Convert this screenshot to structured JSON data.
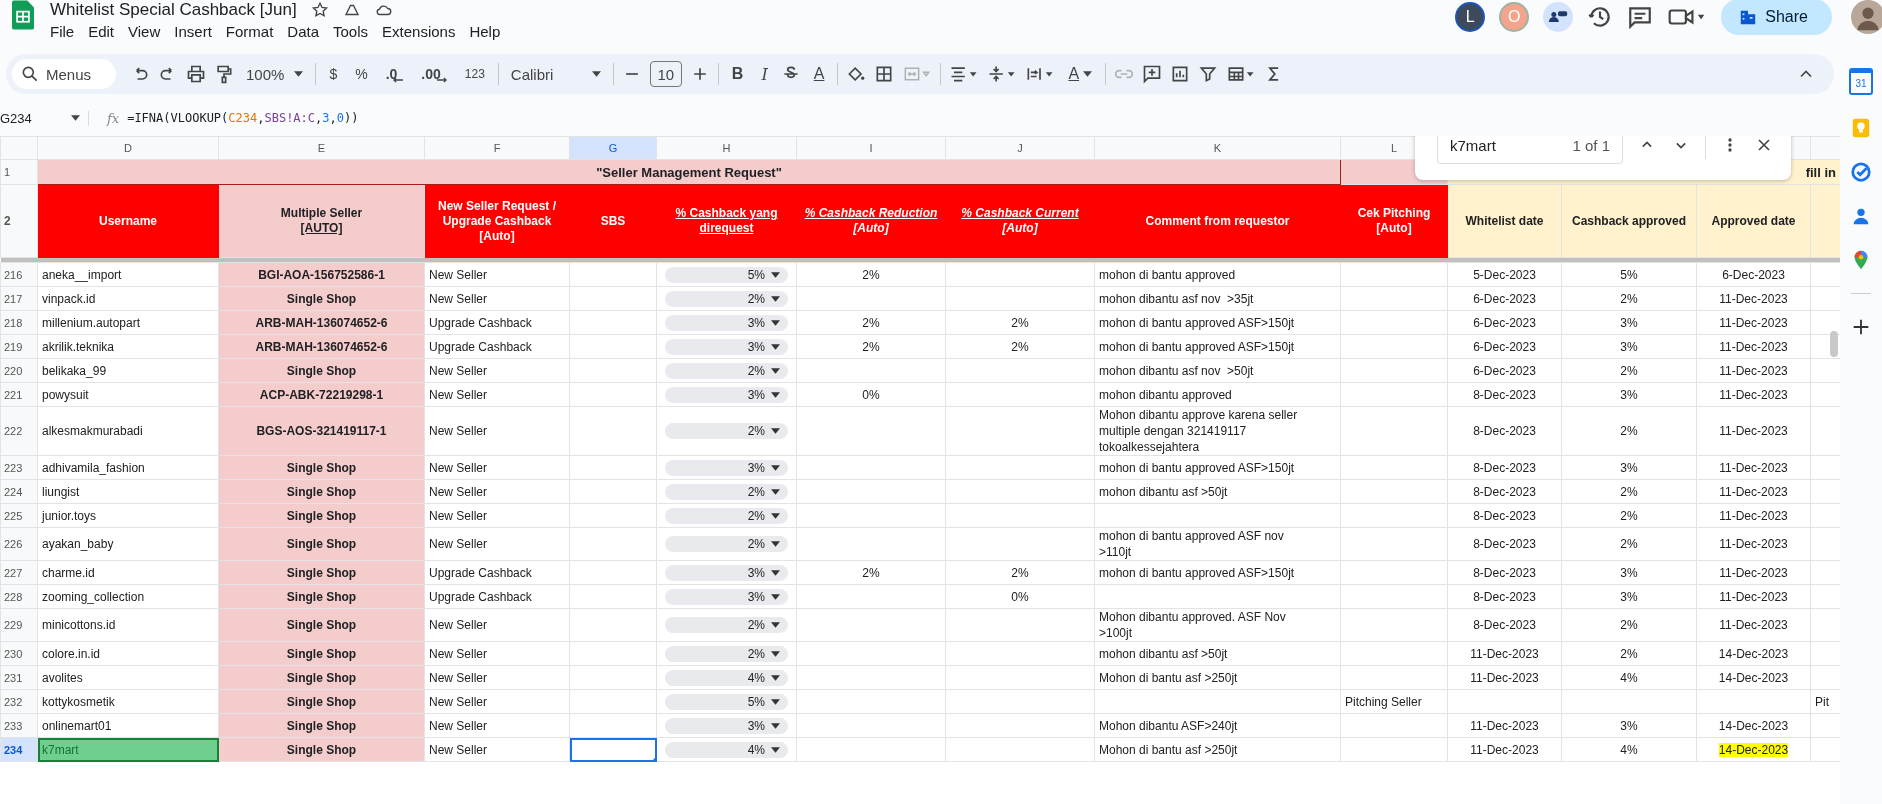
{
  "title": "Whitelist Special Cashback [Jun]",
  "menu": [
    "File",
    "Edit",
    "View",
    "Insert",
    "Format",
    "Data",
    "Tools",
    "Extensions",
    "Help"
  ],
  "collaborators": [
    {
      "initial": "L",
      "color": "#3c4a5c"
    },
    {
      "initial": "O",
      "color": "#f4a48c"
    }
  ],
  "share_label": "Share",
  "toolbar": {
    "search": "Menus",
    "zoom": "100%",
    "currency": "$",
    "percent": "%",
    "decrease_decimals": ".0",
    "increase_decimals": ".00",
    "number_format": "123",
    "font": "Calibri",
    "font_size": "10",
    "bold": "B",
    "italic": "I",
    "text_color": "A",
    "rotate": "A"
  },
  "formula_bar": {
    "cell": "G234",
    "fx": "fx",
    "tokens": [
      {
        "text": "=IFNA(VLOOKUP("
      },
      {
        "text": "C234",
        "color": "#e37400"
      },
      {
        "text": ","
      },
      {
        "text": "SBS!A:C",
        "color": "#7b3f98"
      },
      {
        "text": ","
      },
      {
        "text": "3",
        "color": "#1a73e8"
      },
      {
        "text": ","
      },
      {
        "text": "0",
        "color": "#1a73e8"
      },
      {
        "text": "))"
      }
    ]
  },
  "find": {
    "query": "k7mart",
    "count": "1 of 1"
  },
  "columns": [
    {
      "letter": "D",
      "selected": false
    },
    {
      "letter": "E",
      "selected": false
    },
    {
      "letter": "F",
      "selected": false
    },
    {
      "letter": "G",
      "selected": true
    },
    {
      "letter": "H",
      "selected": false
    },
    {
      "letter": "I",
      "selected": false
    },
    {
      "letter": "J",
      "selected": false
    },
    {
      "letter": "K",
      "selected": false
    },
    {
      "letter": "L",
      "selected": false
    }
  ],
  "row1": {
    "number": "1",
    "title": "\"Seller Management Request\"",
    "project_note": "fill in"
  },
  "row2": {
    "number": "2",
    "headers": [
      {
        "text": "Username",
        "kind": "red",
        "underlined": false,
        "italic": false
      },
      {
        "text": "Multiple Seller",
        "sub": "[AUTO]",
        "kind": "pink",
        "underlined": false,
        "italic": false
      },
      {
        "text": "New Seller Request / Upgrade Cashback [Auto]",
        "kind": "red",
        "underlined": false,
        "italic": false
      },
      {
        "text": "SBS",
        "kind": "red",
        "underlined": false,
        "italic": false
      },
      {
        "text": "% Cashback yang direquest",
        "kind": "red",
        "underlined": true,
        "italic": false
      },
      {
        "text": "% Cashback Reduction",
        "sub": "[Auto]",
        "kind": "red",
        "underlined": true,
        "italic": true
      },
      {
        "text": "% Cashback Current",
        "sub": "[Auto]",
        "kind": "red",
        "underlined": true,
        "italic": true
      },
      {
        "text": "Comment from requestor",
        "kind": "red",
        "underlined": false,
        "italic": false
      },
      {
        "text": "Cek Pitching [Auto]",
        "kind": "red",
        "underlined": false,
        "italic": false
      },
      {
        "text": "Whitelist date",
        "kind": "yellow",
        "underlined": false,
        "italic": false
      },
      {
        "text": "Cashback approved",
        "kind": "yellow",
        "underlined": false,
        "italic": false
      },
      {
        "text": "Approved date",
        "kind": "yellow",
        "underlined": false,
        "italic": false
      }
    ]
  },
  "rows": [
    {
      "number": "216",
      "username": "aneka__import",
      "seller": "BGI-AOA-156752586-1",
      "request": "New Seller",
      "cashback": "5%",
      "reduction": "2%",
      "comment": "mohon di bantu approved",
      "whitelist_date": "5-Dec-2023",
      "approved": "5%",
      "approved_date": "6-Dec-2023",
      "selected": false
    },
    {
      "number": "217",
      "username": "vinpack.id",
      "seller": "Single Shop",
      "request": "New Seller",
      "cashback": "2%",
      "comment": "mohon dibantu asf nov  >35jt",
      "whitelist_date": "6-Dec-2023",
      "approved": "2%",
      "approved_date": "11-Dec-2023",
      "selected": false
    },
    {
      "number": "218",
      "username": "millenium.autopart",
      "seller": "ARB-MAH-136074652-6",
      "request": "Upgrade Cashback",
      "cashback": "3%",
      "reduction": "2%",
      "current": "2%",
      "comment": "mohon di bantu approved ASF>150jt",
      "whitelist_date": "6-Dec-2023",
      "approved": "3%",
      "approved_date": "11-Dec-2023",
      "selected": false
    },
    {
      "number": "219",
      "username": "akrilik.teknika",
      "seller": "ARB-MAH-136074652-6",
      "request": "Upgrade Cashback",
      "cashback": "3%",
      "reduction": "2%",
      "current": "2%",
      "comment": "mohon di bantu approved ASF>150jt",
      "whitelist_date": "6-Dec-2023",
      "approved": "3%",
      "approved_date": "11-Dec-2023",
      "selected": false
    },
    {
      "number": "220",
      "username": "belikaka_99",
      "seller": "Single Shop",
      "request": "New Seller",
      "cashback": "2%",
      "comment": "mohon dibantu asf nov  >50jt",
      "whitelist_date": "6-Dec-2023",
      "approved": "2%",
      "approved_date": "11-Dec-2023",
      "selected": false
    },
    {
      "number": "221",
      "username": "powysuit",
      "seller": "ACP-ABK-72219298-1",
      "request": "New Seller",
      "cashback": "3%",
      "reduction": "0%",
      "comment": "mohon dibantu approved",
      "whitelist_date": "8-Dec-2023",
      "approved": "3%",
      "approved_date": "11-Dec-2023",
      "selected": false
    },
    {
      "number": "222",
      "username": "alkesmakmurabadi",
      "seller": "BGS-AOS-321419117-1",
      "request": "New Seller",
      "cashback": "2%",
      "comment": "Mohon dibantu approve karena seller\nmultiple dengan 321419117\ntokoalkessejahtera",
      "whitelist_date": "8-Dec-2023",
      "approved": "2%",
      "approved_date": "11-Dec-2023",
      "selected": false
    },
    {
      "number": "223",
      "username": "adhivamila_fashion",
      "seller": "Single Shop",
      "request": "New Seller",
      "cashback": "3%",
      "comment": "mohon di bantu approved ASF>150jt",
      "whitelist_date": "8-Dec-2023",
      "approved": "3%",
      "approved_date": "11-Dec-2023",
      "selected": false
    },
    {
      "number": "224",
      "username": "liungist",
      "seller": "Single Shop",
      "request": "New Seller",
      "cashback": "2%",
      "comment": "mohon dibantu asf >50jt",
      "whitelist_date": "8-Dec-2023",
      "approved": "2%",
      "approved_date": "11-Dec-2023",
      "selected": false
    },
    {
      "number": "225",
      "username": "junior.toys",
      "seller": "Single Shop",
      "request": "New Seller",
      "cashback": "2%",
      "whitelist_date": "8-Dec-2023",
      "approved": "2%",
      "approved_date": "11-Dec-2023",
      "selected": false
    },
    {
      "number": "226",
      "username": "ayakan_baby",
      "seller": "Single Shop",
      "request": "New Seller",
      "cashback": "2%",
      "comment": "mohon di bantu approved ASF nov\n>110jt",
      "whitelist_date": "8-Dec-2023",
      "approved": "2%",
      "approved_date": "11-Dec-2023",
      "selected": false
    },
    {
      "number": "227",
      "username": "charme.id",
      "seller": "Single Shop",
      "request": "Upgrade Cashback",
      "cashback": "3%",
      "reduction": "2%",
      "current": "2%",
      "comment": "mohon di bantu approved ASF>150jt",
      "whitelist_date": "8-Dec-2023",
      "approved": "3%",
      "approved_date": "11-Dec-2023",
      "selected": false
    },
    {
      "number": "228",
      "username": "zooming_collection",
      "seller": "Single Shop",
      "request": "Upgrade Cashback",
      "cashback": "3%",
      "current": "0%",
      "whitelist_date": "8-Dec-2023",
      "approved": "3%",
      "approved_date": "11-Dec-2023",
      "selected": false
    },
    {
      "number": "229",
      "username": "minicottons.id",
      "seller": "Single Shop",
      "request": "New Seller",
      "cashback": "2%",
      "comment": "Mohon dibantu approved. ASF Nov\n>100jt",
      "whitelist_date": "8-Dec-2023",
      "approved": "2%",
      "approved_date": "11-Dec-2023",
      "selected": false
    },
    {
      "number": "230",
      "username": "colore.in.id",
      "seller": "Single Shop",
      "request": "New Seller",
      "cashback": "2%",
      "comment": "mohon dibantu asf >50jt",
      "whitelist_date": "11-Dec-2023",
      "approved": "2%",
      "approved_date": "14-Dec-2023",
      "selected": false
    },
    {
      "number": "231",
      "username": "avolites",
      "seller": "Single Shop",
      "request": "New Seller",
      "cashback": "4%",
      "comment": "Mohon di bantu asf >250jt",
      "whitelist_date": "11-Dec-2023",
      "approved": "4%",
      "approved_date": "14-Dec-2023",
      "selected": false
    },
    {
      "number": "232",
      "username": "kottykosmetik",
      "seller": "Single Shop",
      "request": "New Seller",
      "cashback": "5%",
      "pitching": "Pitching Seller",
      "extra": "Pit",
      "selected": false
    },
    {
      "number": "233",
      "username": "onlinemart01",
      "seller": "Single Shop",
      "request": "New Seller",
      "cashback": "3%",
      "comment": "Mohon dibantu ASF>240jt",
      "whitelist_date": "11-Dec-2023",
      "approved": "3%",
      "approved_date": "14-Dec-2023",
      "selected": false
    },
    {
      "number": "234",
      "username": "k7mart",
      "seller": "Single Shop",
      "request": "New Seller",
      "cashback": "4%",
      "comment": "Mohon di bantu asf >250jt",
      "whitelist_date": "11-Dec-2023",
      "approved": "4%",
      "approved_date": "14-Dec-2023",
      "selected": true,
      "find_match": true,
      "date_highlighted": true
    }
  ],
  "sidebar": {
    "calendar_day": "31"
  }
}
